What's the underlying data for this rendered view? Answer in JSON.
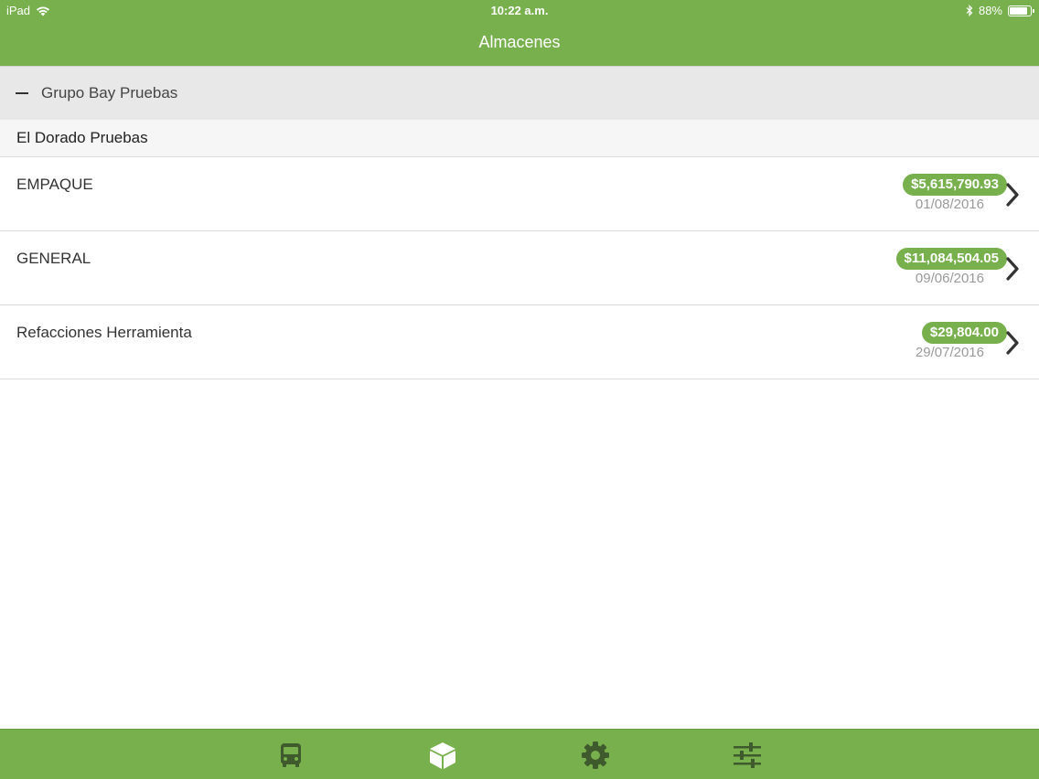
{
  "status_bar": {
    "device": "iPad",
    "time": "10:22 a.m.",
    "battery": "88%",
    "battery_level": 0.88
  },
  "nav": {
    "title": "Almacenes"
  },
  "group": {
    "label": "Grupo Bay Pruebas",
    "icon": "collapse-minus-icon"
  },
  "section": {
    "label": "El Dorado Pruebas"
  },
  "warehouses": [
    {
      "name": "EMPAQUE",
      "amount": "$5,615,790.93",
      "date": "01/08/2016"
    },
    {
      "name": "GENERAL",
      "amount": "$11,084,504.05",
      "date": "09/06/2016"
    },
    {
      "name": "Refacciones Herramienta",
      "amount": "$29,804.00",
      "date": "29/07/2016"
    }
  ],
  "tabs": [
    {
      "icon": "bus-icon",
      "active": false
    },
    {
      "icon": "box-icon",
      "active": true
    },
    {
      "icon": "gear-icon",
      "active": false
    },
    {
      "icon": "sliders-icon",
      "active": false
    }
  ],
  "colors": {
    "accent": "#78b04d",
    "tab_inactive": "#3f5a2c",
    "tab_active": "#ffffff"
  }
}
